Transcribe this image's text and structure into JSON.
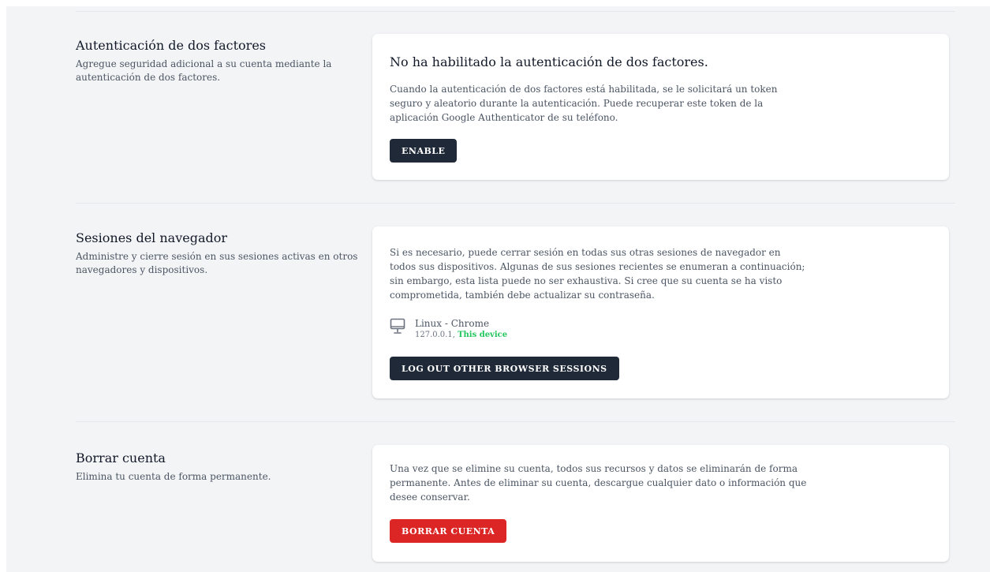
{
  "two_factor": {
    "title": "Autenticación de dos factores",
    "description": "Agregue seguridad adicional a su cuenta mediante la autenticación de dos factores.",
    "status_heading": "No ha habilitado la autenticación de dos factores.",
    "explanation": "Cuando la autenticación de dos factores está habilitada, se le solicitará un token seguro y aleatorio durante la autenticación. Puede recuperar este token de la aplicación Google Authenticator de su teléfono.",
    "enable_label": "ENABLE"
  },
  "browser_sessions": {
    "title": "Sesiones del navegador",
    "description": "Administre y cierre sesión en sus sesiones activas en otros navegadores y dispositivos.",
    "explanation": "Si es necesario, puede cerrar sesión en todas sus otras sesiones de navegador en todos sus dispositivos. Algunas de sus sesiones recientes se enumeran a continuación; sin embargo, esta lista puede no ser exhaustiva. Si cree que su cuenta se ha visto comprometida, también debe actualizar su contraseña.",
    "sessions": [
      {
        "icon": "desktop-monitor-icon",
        "name": "Linux - Chrome",
        "ip": "127.0.0.1,",
        "current_label": "This device"
      }
    ],
    "logout_label": "LOG OUT OTHER BROWSER SESSIONS"
  },
  "delete_account": {
    "title": "Borrar cuenta",
    "description": "Elimina tu cuenta de forma permanente.",
    "explanation": "Una vez que se elimine su cuenta, todos sus recursos y datos se eliminarán de forma permanente. Antes de eliminar su cuenta, descargue cualquier dato o información que desee conservar.",
    "delete_label": "BORRAR CUENTA"
  },
  "colors": {
    "primary_button": "#1f2937",
    "danger_button": "#dc2626",
    "current_device": "#22c55e",
    "background": "#f3f4f6"
  }
}
